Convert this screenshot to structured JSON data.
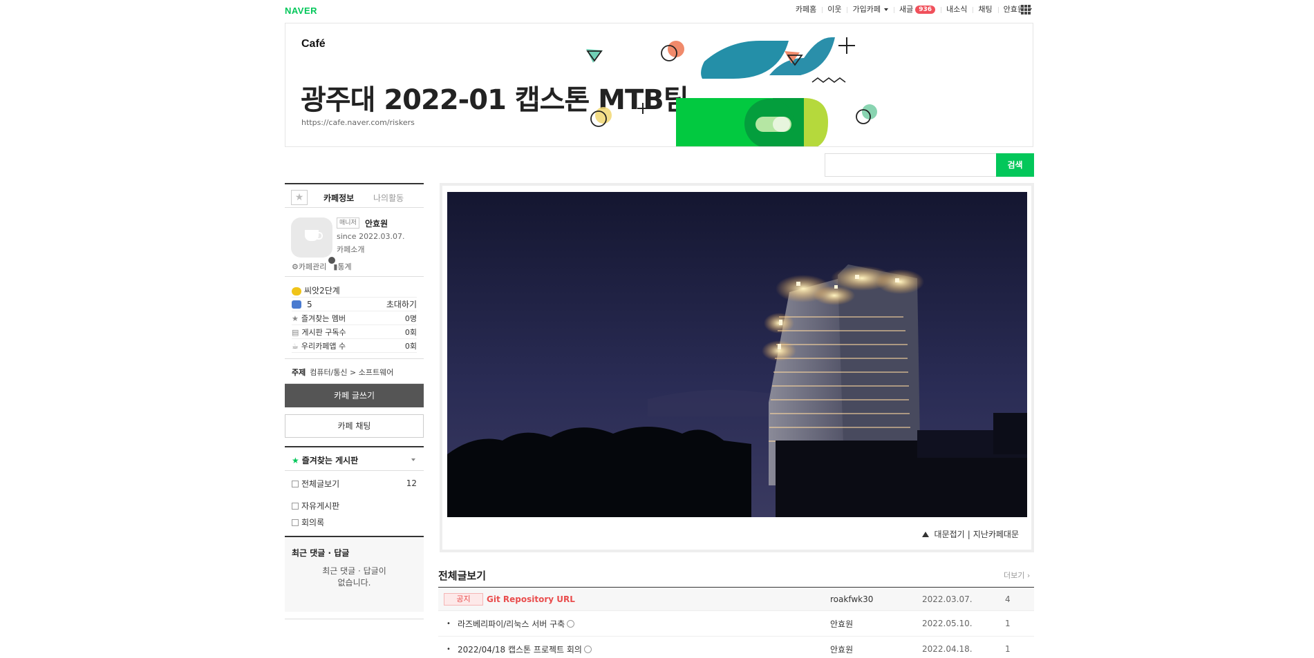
{
  "gnb": {
    "logo": "NAVER",
    "menu": [
      {
        "label": "카페홈"
      },
      {
        "label": "이웃"
      },
      {
        "label": "가입카페",
        "dropdown": true
      },
      {
        "label": "새글",
        "badge": "936"
      },
      {
        "label": "내소식"
      },
      {
        "label": "채팅"
      },
      {
        "label": "안효원",
        "dropdown": true
      }
    ],
    "apps_icon": "grid-icon"
  },
  "banner": {
    "brand": "Café",
    "title": "광주대 2022-01 캡스톤 MTB팀",
    "url": "https://cafe.naver.com/riskers"
  },
  "search": {
    "placeholder": "",
    "button": "검색"
  },
  "sidebar": {
    "tabs": {
      "info": "카페정보",
      "activity": "나의활동"
    },
    "profile": {
      "role": "매니저",
      "name": "안효원",
      "since": "since 2022.03.07.",
      "intro": "카페소개",
      "manage": "카페관리",
      "stats_link": "통계"
    },
    "level": "씨앗2단계",
    "members": "5",
    "invite": "초대하기",
    "stats": [
      {
        "label": "즐겨찾는 멤버",
        "value": "0명"
      },
      {
        "label": "게시판 구독수",
        "value": "0회"
      },
      {
        "label": "우리카페앱 수",
        "value": "0회"
      }
    ],
    "topic": {
      "label": "주제",
      "value": "컴퓨터/통신 > 소프트웨어"
    },
    "write_button": "카페 글쓰기",
    "chat_button": "카페 채팅",
    "fav_boards_title": "즐겨찾는 게시판",
    "boards": [
      {
        "name": "전체글보기",
        "count": "12"
      },
      {
        "name": "자유게시판",
        "count": ""
      },
      {
        "name": "회의록",
        "count": ""
      }
    ],
    "recent": {
      "title": "최근 댓글 · 답글",
      "empty_line1": "최근 댓글 · 답글이",
      "empty_line2": "없습니다."
    }
  },
  "main": {
    "photo_links": {
      "collapse": "대문접기",
      "separator": "|",
      "past": "지난카페대문"
    },
    "list_title": "전체글보기",
    "more": "더보기",
    "posts": [
      {
        "notice": true,
        "tag": "공지",
        "title": "Git Repository URL",
        "author": "roakfwk30",
        "date": "2022.03.07.",
        "views": "4"
      },
      {
        "notice": false,
        "title": "라즈베리파이/리눅스 서버 구축",
        "author": "안효원",
        "date": "2022.05.10.",
        "views": "1"
      },
      {
        "notice": false,
        "title": "2022/04/18 캡스톤 프로젝트 회의",
        "author": "안효원",
        "date": "2022.04.18.",
        "views": "1"
      }
    ]
  },
  "colors": {
    "accent": "#03c75a",
    "notice": "#e94d4d",
    "badge": "#f0505b"
  }
}
